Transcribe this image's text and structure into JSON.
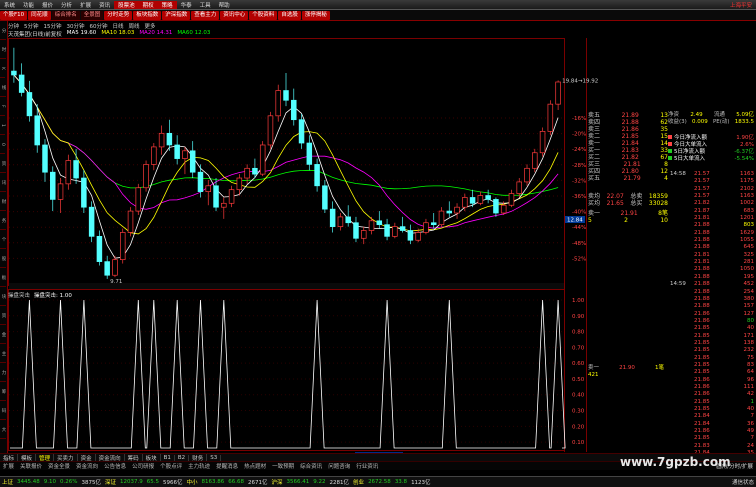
{
  "menubar": {
    "items": [
      "系统",
      "功能",
      "报价",
      "分析",
      "扩展",
      "资讯",
      "华泰",
      "工具",
      "帮助"
    ],
    "highlight": "股票池",
    "highlight2": "期权",
    "highlight3": "策略",
    "right": "上海平安"
  },
  "tabs": [
    {
      "label": "个股F10",
      "on": true
    },
    {
      "label": "同花顺",
      "on": true
    },
    {
      "label": "综合排名",
      "on": false
    },
    {
      "label": "全景图",
      "on": false
    },
    {
      "label": "分时走势",
      "on": true
    },
    {
      "label": "板块指数",
      "on": true
    },
    {
      "label": "沪深指数",
      "on": true
    },
    {
      "label": "查看主力",
      "on": true
    },
    {
      "label": "资讯中心",
      "on": true
    },
    {
      "label": "个股资料",
      "on": true
    },
    {
      "label": "自选股",
      "on": true
    },
    {
      "label": "涨停揭秘",
      "on": true
    }
  ],
  "left_strip": [
    "分",
    "时",
    "K",
    "线",
    "F",
    "1",
    "0",
    "资",
    "讯",
    "财",
    "务",
    "个",
    "股",
    "板",
    "块",
    "资",
    "金",
    "主",
    "力",
    "筹",
    "码",
    "大"
  ],
  "main_tools": [
    "分钟",
    "5分钟",
    "15分钟",
    "30分钟",
    "60分钟",
    "日线",
    "周线",
    "更多"
  ],
  "main_legend": [
    {
      "label": "天茂集团(日线)前复权",
      "color": "#dddddd"
    },
    {
      "label": "MA5 19.60",
      "color": "#ffffff"
    },
    {
      "label": "MA10 18.03",
      "color": "#ffff00"
    },
    {
      "label": "MA20 14.31",
      "color": "#ff00ff"
    },
    {
      "label": "MA60 12.03",
      "color": "#00ff00"
    }
  ],
  "price_axis": [
    "-16%",
    "-20%",
    "-24%",
    "-28%",
    "-32%",
    "-36%",
    "-40%",
    "-44%",
    "-48%",
    "-52%"
  ],
  "osc_axis": [
    "1.00",
    "0.90",
    "0.80",
    "0.70",
    "0.60",
    "0.50",
    "0.40",
    "0.30",
    "0.20",
    "0.10"
  ],
  "sub_legend": [
    {
      "label": "操盘突击",
      "color": "#cccccc"
    },
    {
      "label": "操盘突击: 1.00",
      "color": "#ffffff"
    }
  ],
  "chart_labels": {
    "high": "19.84→19.92",
    "low": "9.71",
    "current": "12.84",
    "x_labels": [
      "2015年7",
      "8",
      "9",
      "10",
      "11"
    ],
    "selected_date": "20150929二",
    "axis_unit": "日线"
  },
  "chart_data": {
    "type": "candlestick",
    "candles": [
      [
        20.4,
        21.6,
        19.8,
        20.2
      ],
      [
        20.2,
        20.8,
        19.1,
        19.3
      ],
      [
        19.3,
        19.9,
        17.8,
        18.1
      ],
      [
        18.1,
        18.7,
        16.2,
        16.6
      ],
      [
        16.6,
        16.9,
        14.7,
        15.2
      ],
      [
        15.2,
        15.5,
        13.2,
        13.8
      ],
      [
        13.8,
        14.9,
        13.1,
        14.6
      ],
      [
        14.6,
        16.1,
        14.3,
        15.8
      ],
      [
        15.8,
        16.4,
        14.6,
        14.9
      ],
      [
        14.9,
        15.3,
        13.1,
        13.4
      ],
      [
        13.4,
        13.7,
        11.6,
        11.9
      ],
      [
        11.9,
        12.2,
        10.4,
        10.6
      ],
      [
        10.6,
        10.9,
        9.71,
        9.9
      ],
      [
        9.9,
        10.9,
        9.8,
        10.7
      ],
      [
        10.7,
        12.3,
        10.5,
        12.1
      ],
      [
        12.1,
        13.4,
        11.9,
        13.2
      ],
      [
        13.2,
        14.6,
        13.0,
        14.4
      ],
      [
        14.4,
        15.8,
        14.2,
        15.6
      ],
      [
        15.6,
        16.7,
        15.3,
        16.5
      ],
      [
        16.5,
        17.6,
        16.1,
        17.2
      ],
      [
        17.2,
        17.9,
        16.3,
        16.6
      ],
      [
        16.6,
        17.1,
        15.6,
        15.9
      ],
      [
        15.9,
        16.5,
        15.1,
        16.3
      ],
      [
        16.3,
        16.8,
        14.9,
        15.2
      ],
      [
        15.2,
        15.6,
        13.9,
        14.2
      ],
      [
        14.2,
        14.8,
        13.5,
        14.5
      ],
      [
        14.5,
        14.9,
        13.2,
        13.4
      ],
      [
        13.4,
        13.9,
        12.8,
        13.6
      ],
      [
        13.6,
        14.5,
        13.4,
        14.3
      ],
      [
        14.3,
        15.1,
        14.0,
        14.9
      ],
      [
        14.9,
        15.6,
        14.6,
        15.4
      ],
      [
        15.4,
        15.9,
        14.9,
        15.1
      ],
      [
        15.1,
        16.8,
        15.0,
        16.6
      ],
      [
        16.6,
        18.3,
        16.4,
        18.1
      ],
      [
        18.1,
        19.7,
        17.8,
        19.4
      ],
      [
        19.4,
        20.3,
        18.6,
        18.9
      ],
      [
        18.9,
        19.5,
        17.6,
        17.9
      ],
      [
        17.9,
        18.2,
        16.4,
        16.7
      ],
      [
        16.7,
        17.1,
        15.3,
        15.6
      ],
      [
        15.6,
        15.9,
        14.2,
        14.5
      ],
      [
        14.5,
        14.8,
        13.1,
        13.3
      ],
      [
        13.3,
        13.7,
        12.1,
        12.4
      ],
      [
        12.4,
        13.1,
        12.2,
        12.9
      ],
      [
        12.9,
        13.5,
        12.4,
        12.6
      ],
      [
        12.6,
        12.9,
        11.6,
        11.8
      ],
      [
        11.8,
        12.4,
        11.5,
        12.2
      ],
      [
        12.2,
        12.9,
        12.0,
        12.7
      ],
      [
        12.7,
        13.2,
        12.3,
        12.5
      ],
      [
        12.5,
        12.8,
        11.7,
        11.9
      ],
      [
        11.9,
        12.6,
        11.8,
        12.4
      ],
      [
        12.4,
        12.9,
        12.1,
        12.2
      ],
      [
        12.2,
        12.5,
        11.5,
        11.7
      ],
      [
        11.7,
        12.3,
        11.6,
        12.1
      ],
      [
        12.1,
        12.8,
        12.0,
        12.6
      ],
      [
        12.6,
        13.1,
        12.3,
        12.5
      ],
      [
        12.5,
        13.4,
        12.4,
        13.2
      ],
      [
        13.2,
        13.7,
        12.9,
        13.1
      ],
      [
        13.1,
        13.6,
        12.8,
        13.4
      ],
      [
        13.4,
        14.1,
        13.2,
        13.9
      ],
      [
        13.9,
        14.3,
        13.4,
        13.6
      ],
      [
        13.6,
        14.2,
        13.5,
        14.0
      ],
      [
        14.0,
        14.3,
        13.6,
        13.8
      ],
      [
        13.8,
        13.9,
        12.9,
        13.1
      ],
      [
        13.1,
        13.7,
        13.0,
        13.5
      ],
      [
        13.5,
        14.3,
        13.4,
        14.1
      ],
      [
        14.1,
        14.9,
        13.9,
        14.7
      ],
      [
        14.7,
        15.6,
        14.5,
        15.4
      ],
      [
        15.4,
        16.4,
        15.2,
        16.2
      ],
      [
        16.2,
        17.5,
        16.0,
        17.3
      ],
      [
        17.3,
        18.9,
        17.1,
        18.7
      ],
      [
        18.7,
        19.92,
        18.4,
        19.84
      ]
    ],
    "ma_colors": {
      "MA5": "#ffffff",
      "MA10": "#ffff00",
      "MA20": "#ff00ff",
      "MA60": "#00ff00"
    },
    "oscillator": {
      "name": "操盘突击",
      "ylim": [
        0,
        1
      ],
      "spikes": [
        2,
        6,
        9,
        16,
        18,
        21,
        24,
        27,
        39,
        48,
        56,
        68,
        70
      ]
    },
    "price_range": [
      9.5,
      22
    ]
  },
  "order_book": {
    "sells": [
      {
        "label": "卖五",
        "price": "21.89",
        "vol": "13"
      },
      {
        "label": "卖四",
        "price": "21.88",
        "vol": "62"
      },
      {
        "label": "卖三",
        "price": "21.86",
        "vol": "35"
      },
      {
        "label": "卖二",
        "price": "21.85",
        "vol": "15"
      },
      {
        "label": "卖一",
        "price": "21.84",
        "vol": "14"
      }
    ],
    "buys": [
      {
        "label": "买一",
        "price": "21.83",
        "vol": "33"
      },
      {
        "label": "买二",
        "price": "21.82",
        "vol": "67"
      },
      {
        "label": "买三",
        "price": "21.81",
        "vol": "8"
      },
      {
        "label": "买四",
        "price": "21.80",
        "vol": "12"
      },
      {
        "label": "买五",
        "price": "21.79",
        "vol": "4"
      }
    ],
    "summary": [
      {
        "label": "卖均",
        "price": "22.07",
        "tag": "总卖",
        "vol": "18359"
      },
      {
        "label": "买均",
        "price": "21.65",
        "tag": "总买",
        "vol": "33028"
      }
    ],
    "buy1": {
      "label": "卖一",
      "price": "21.91",
      "vol": "8笔"
    },
    "buy1_extra": [
      "5",
      "2",
      "10"
    ]
  },
  "info": [
    {
      "label": "净资",
      "value": "2.49",
      "label2": "流通",
      "value2": "5.09亿"
    },
    {
      "label": "收益(3)",
      "value": "0.009",
      "label2": "PE(动)",
      "value2": "1833.5"
    }
  ],
  "flows": [
    {
      "label": "今日净流入额",
      "value": "1.90亿",
      "color": "#ff4444",
      "swatch": "#ff4444"
    },
    {
      "label": "今日大单流入",
      "value": "2.6%",
      "color": "#ff4444",
      "swatch": "#ff4444"
    },
    {
      "label": "5日净流入额",
      "value": "-6.37亿",
      "color": "#22cc22",
      "swatch": "#22cc22"
    },
    {
      "label": "5日大单流入",
      "value": "-5.54%",
      "color": "#22cc22",
      "swatch": "#22cc22"
    }
  ],
  "tick_times": [
    {
      "t": "14:58",
      "row": 0
    },
    {
      "t": "14:59",
      "row": 15
    }
  ],
  "ticks": [
    {
      "p": "21.57",
      "v": "1163",
      "c": "r"
    },
    {
      "p": "21.57",
      "v": "1175",
      "c": "r"
    },
    {
      "p": "21.57",
      "v": "2102",
      "c": "r"
    },
    {
      "p": "21.57",
      "v": "1163",
      "c": "r"
    },
    {
      "p": "21.82",
      "v": "1002",
      "c": "r"
    },
    {
      "p": "21.87",
      "v": "683",
      "c": "r"
    },
    {
      "p": "21.81",
      "v": "1201",
      "c": "r"
    },
    {
      "p": "21.88",
      "v": "803",
      "c": "y"
    },
    {
      "p": "21.88",
      "v": "1629",
      "c": "r"
    },
    {
      "p": "21.88",
      "v": "1055",
      "c": "r"
    },
    {
      "p": "21.88",
      "v": "645",
      "c": "r"
    },
    {
      "p": "21.81",
      "v": "325",
      "c": "r"
    },
    {
      "p": "21.81",
      "v": "281",
      "c": "r"
    },
    {
      "p": "21.88",
      "v": "1050",
      "c": "r"
    },
    {
      "p": "21.88",
      "v": "195",
      "c": "r"
    },
    {
      "p": "21.88",
      "v": "452",
      "c": "r"
    },
    {
      "p": "21.88",
      "v": "254",
      "c": "r"
    },
    {
      "p": "21.88",
      "v": "380",
      "c": "r"
    },
    {
      "p": "21.88",
      "v": "157",
      "c": "r"
    },
    {
      "p": "21.86",
      "v": "127",
      "c": "r"
    },
    {
      "p": "21.86",
      "v": "80",
      "c": "g"
    },
    {
      "p": "21.85",
      "v": "40",
      "c": "r"
    },
    {
      "p": "21.85",
      "v": "171",
      "c": "r"
    },
    {
      "p": "21.85",
      "v": "138",
      "c": "r"
    },
    {
      "p": "21.85",
      "v": "232",
      "c": "r"
    },
    {
      "p": "21.85",
      "v": "75",
      "c": "r"
    },
    {
      "p": "21.85",
      "v": "83",
      "c": "r"
    },
    {
      "p": "21.85",
      "v": "64",
      "c": "r"
    },
    {
      "p": "21.86",
      "v": "96",
      "c": "r"
    },
    {
      "p": "21.86",
      "v": "111",
      "c": "r"
    },
    {
      "p": "21.86",
      "v": "42",
      "c": "r"
    },
    {
      "p": "21.85",
      "v": "1",
      "c": "g"
    },
    {
      "p": "21.85",
      "v": "40",
      "c": "r"
    },
    {
      "p": "21.84",
      "v": "7",
      "c": "r"
    },
    {
      "p": "21.84",
      "v": "36",
      "c": "r"
    },
    {
      "p": "21.86",
      "v": "49",
      "c": "r"
    },
    {
      "p": "21.85",
      "v": "7",
      "c": "r"
    },
    {
      "p": "21.83",
      "v": "24",
      "c": "r"
    },
    {
      "p": "21.84",
      "v": "35",
      "c": "r"
    },
    {
      "p": "21.86",
      "v": "110",
      "c": "r"
    }
  ],
  "sellbox": {
    "label": "卖一",
    "price": "21.90",
    "vol": "1笔",
    "sub": "421"
  },
  "bottom_tabs": [
    {
      "label": "指标",
      "on": false
    },
    {
      "label": "模板",
      "on": false
    },
    {
      "label": "管理",
      "on": true
    },
    {
      "label": "买卖力",
      "on": false
    },
    {
      "label": "资金",
      "on": false
    },
    {
      "label": "资金流向",
      "on": false
    },
    {
      "label": "筹码",
      "on": false
    },
    {
      "label": "板块",
      "on": false
    },
    {
      "label": "B1",
      "on": false
    },
    {
      "label": "B2",
      "on": false
    },
    {
      "label": "财务",
      "on": false
    },
    {
      "label": "S3",
      "on": false
    }
  ],
  "bottom_tabs2": [
    "扩展",
    "关联报价",
    "资金全景",
    "资金流向",
    "公告信息",
    "公司研报",
    "个股点评",
    "主力轨迹",
    "提醒消息",
    "热点题材",
    "一致预期",
    "综合资讯",
    "问题咨询",
    "行业资讯"
  ],
  "bottom_right": "圆角/分时/扩展",
  "status": [
    {
      "t": "上证",
      "c": "lb"
    },
    {
      "t": "3445.48",
      "c": "dn"
    },
    {
      "t": "9.10",
      "c": "dn"
    },
    {
      "t": "0.26%",
      "c": "dn"
    },
    {
      "t": "3875亿",
      "c": ""
    },
    {
      "t": "深证",
      "c": "lb"
    },
    {
      "t": "12037.9",
      "c": "dn"
    },
    {
      "t": "65.5",
      "c": "dn"
    },
    {
      "t": "5966亿",
      "c": ""
    },
    {
      "t": "中小",
      "c": "lb"
    },
    {
      "t": "8163.86",
      "c": "dn"
    },
    {
      "t": "66.68",
      "c": "dn"
    },
    {
      "t": "2671亿",
      "c": ""
    },
    {
      "t": "沪深",
      "c": "lb"
    },
    {
      "t": "3566.41",
      "c": "dn"
    },
    {
      "t": "9.22",
      "c": "dn"
    },
    {
      "t": "2281亿",
      "c": ""
    },
    {
      "t": "创业",
      "c": "lb"
    },
    {
      "t": "2672.58",
      "c": "dn"
    },
    {
      "t": "33.8",
      "c": "dn"
    },
    {
      "t": "1123亿",
      "c": ""
    }
  ],
  "status_right": "通信状态",
  "watermark": "www.7gpzb.com"
}
